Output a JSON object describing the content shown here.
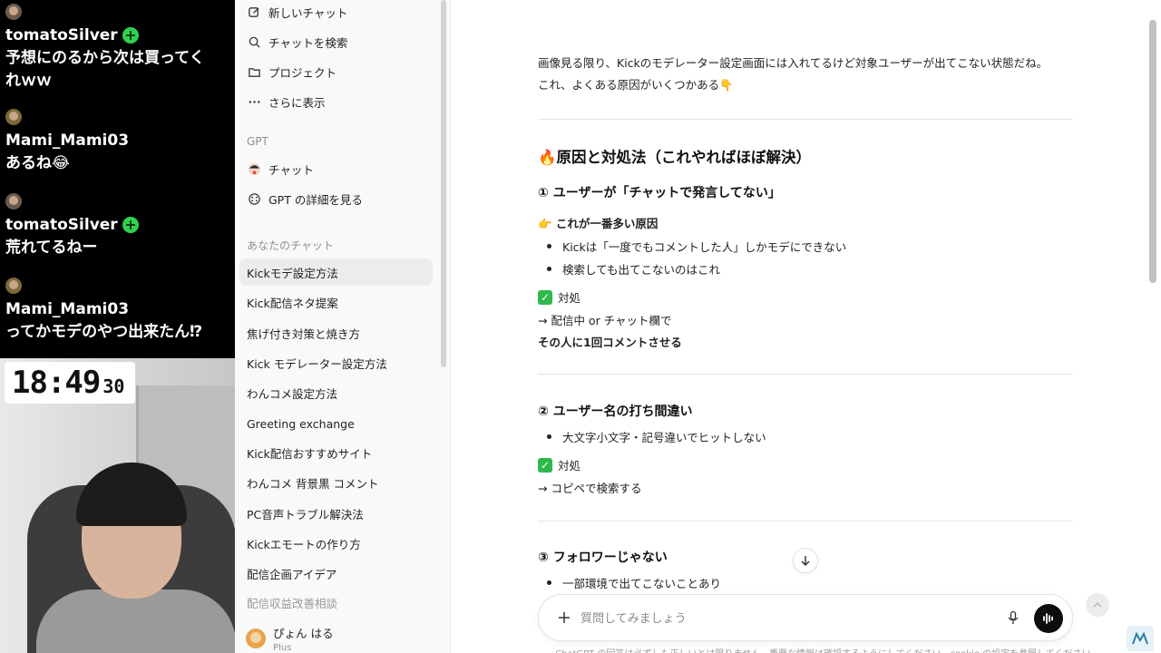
{
  "stream": {
    "messages": [
      {
        "user": "tomatoSilver",
        "verified": true,
        "text_lines": [
          "予想にのるから次は買ってく",
          "れｗｗ"
        ]
      },
      {
        "user": "Mami_Mami03",
        "verified": false,
        "text_lines": [
          "あるね😂"
        ]
      },
      {
        "user": "tomatoSilver",
        "verified": true,
        "text_lines": [
          "荒れてるねー"
        ]
      },
      {
        "user": "Mami_Mami03",
        "verified": false,
        "text_lines": [
          "ってかモデのやつ出来たん⁉"
        ]
      }
    ],
    "clock": {
      "main": "18:49",
      "seconds": "30"
    }
  },
  "sidebar": {
    "top_items": [
      {
        "label": "新しいチャット",
        "icon": "edit-icon"
      },
      {
        "label": "チャットを検索",
        "icon": "search-icon"
      },
      {
        "label": "プロジェクト",
        "icon": "folder-icon"
      },
      {
        "label": "さらに表示",
        "icon": "more-icon"
      }
    ],
    "gpt_section_label": "GPT",
    "gpt_items": [
      {
        "label": "チャット",
        "icon": "gpt-avatar-icon"
      },
      {
        "label": "GPT の詳細を見る",
        "icon": "grid-icon"
      }
    ],
    "history_section_label": "あなたのチャット",
    "history": [
      "Kickモデ設定方法",
      "Kick配信ネタ提案",
      "焦げ付き対策と焼き方",
      "Kick モデレーター設定方法",
      "わんコメ設定方法",
      "Greeting exchange",
      "Kick配信おすすめサイト",
      "わんコメ 背景黒 コメント",
      "PC音声トラブル解決法",
      "Kickエモートの作り方",
      "配信企画アイデア",
      "配信収益改善相談"
    ],
    "user": {
      "name": "ぴょん はる",
      "plan": "Plus"
    }
  },
  "main": {
    "intro_line1": "画像見る限り、Kickのモデレーター設定画面には入れてるけど対象ユーザーが出てこない状態だね。",
    "intro_line2": "これ、よくある原因がいくつかある👇",
    "heading": "🔥原因と対処法（これやればほぼ解決）",
    "s1_title": "① ユーザーが「チャットで発言してない」",
    "s1_sub": "👉 これが一番多い原因",
    "s1_b1": "Kickは「一度でもコメントした人」しかモデにできない",
    "s1_b2": "検索しても出てこないのはこれ",
    "fix_label": "対処",
    "s1_fix1": "→ 配信中 or チャット欄で",
    "s1_fix2": "その人に1回コメントさせる",
    "s2_title": "② ユーザー名の打ち間違い",
    "s2_b1": "大文字小文字・記号違いでヒットしない",
    "s2_fix1": "→ コピペで検索する",
    "s3_title": "③ フォロワーじゃない",
    "s3_b1": "一部環境で出てこないことあり",
    "composer_placeholder": "質問してみましょう",
    "footnote": "ChatGPT の回答は必ずしも正しいとは限りません。重要な情報は確認するようにしてください。cookie の設定を参照してください。"
  },
  "colors": {
    "check": "#2fb84b",
    "verified": "#2fd14f"
  }
}
